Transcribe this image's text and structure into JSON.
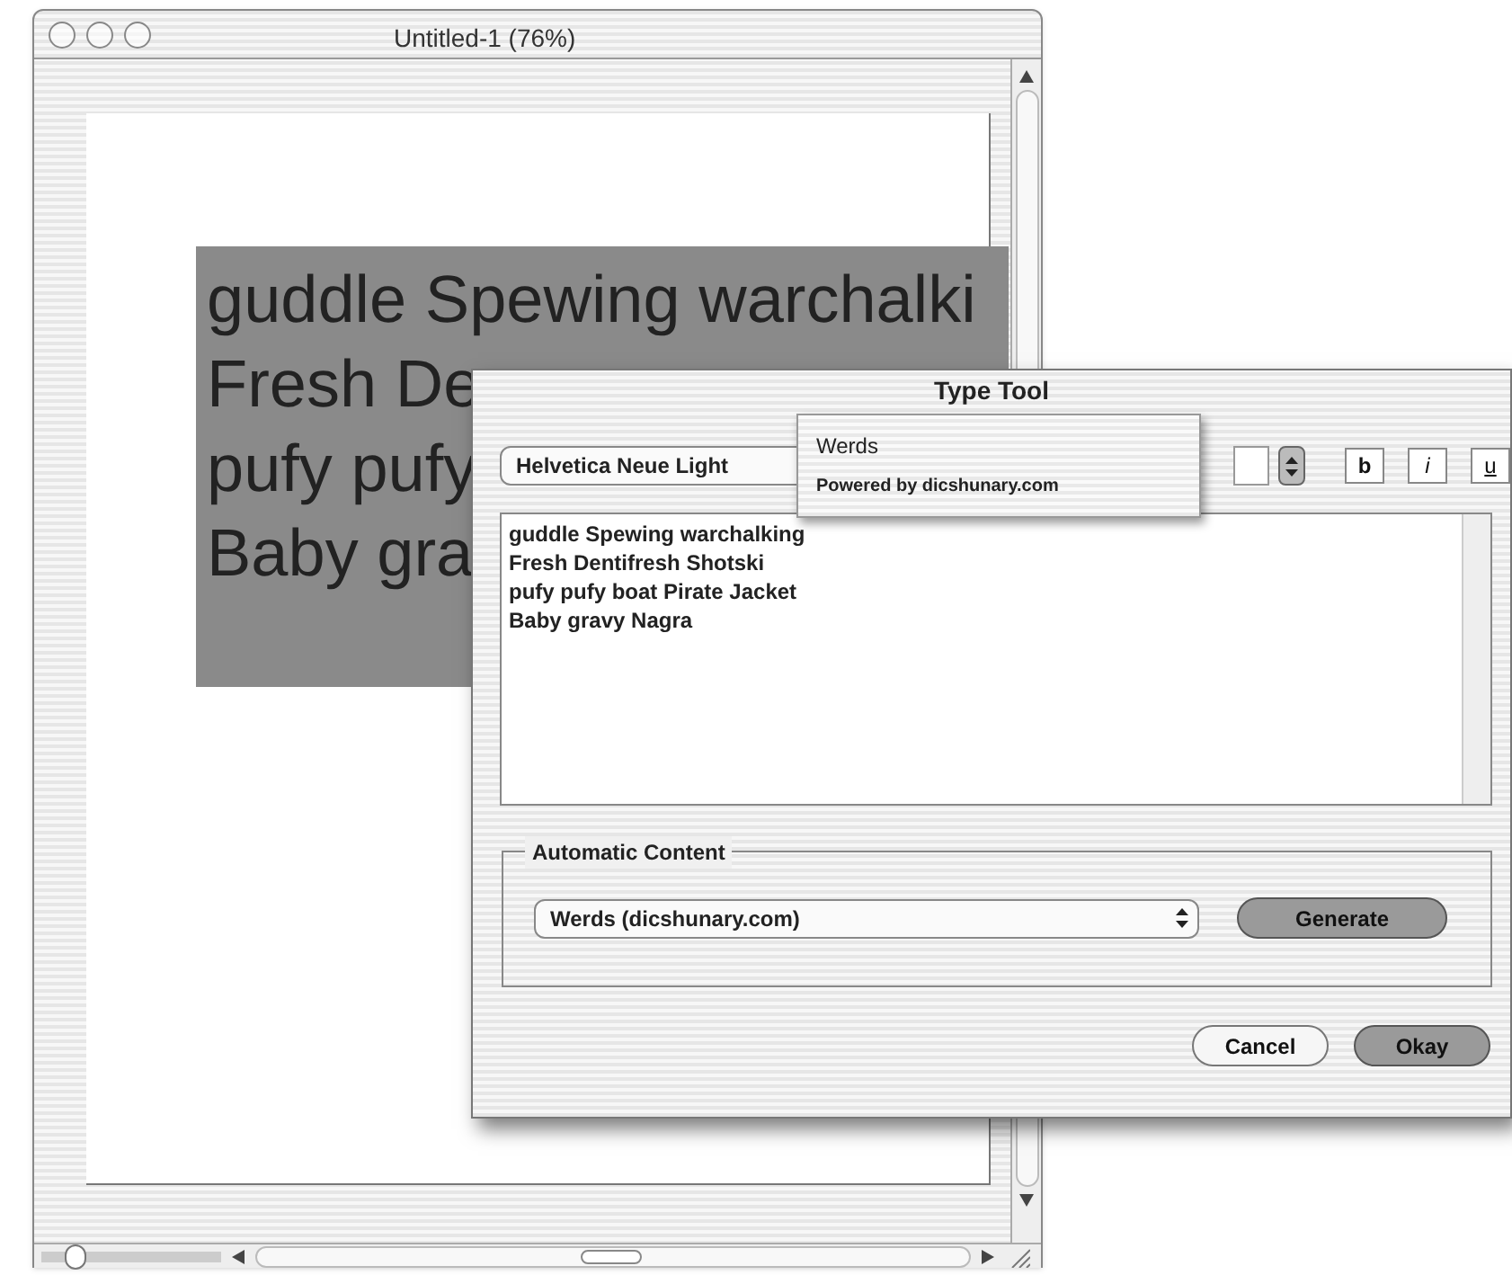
{
  "document_window": {
    "title": "Untitled-1 (76%)",
    "zoom_slider": {
      "level": 0.15
    },
    "canvas_text": [
      "guddle Spewing warchalki",
      "Fresh De",
      "pufy pufy",
      "Baby gra"
    ]
  },
  "dialog": {
    "title": "Type Tool",
    "font": "Helvetica Neue Light",
    "style_buttons": [
      {
        "label": "b",
        "kind": "bold"
      },
      {
        "label": "i",
        "kind": "italic"
      },
      {
        "label": "u",
        "kind": "underline"
      }
    ],
    "popup_menu": [
      {
        "label": "Werds",
        "kind": "item"
      },
      {
        "label": "Powered by dicshunary.com",
        "kind": "note"
      }
    ],
    "text_lines": [
      "guddle Spewing warchalking",
      "Fresh Dentifresh Shotski",
      "pufy pufy boat Pirate Jacket",
      "Baby gravy Nagra"
    ],
    "automatic_content": {
      "label": "Automatic Content",
      "source": "Werds (dicshunary.com)",
      "button": "Generate"
    },
    "buttons": [
      {
        "label": "Cancel",
        "default": false
      },
      {
        "label": "Okay",
        "default": true
      }
    ]
  }
}
